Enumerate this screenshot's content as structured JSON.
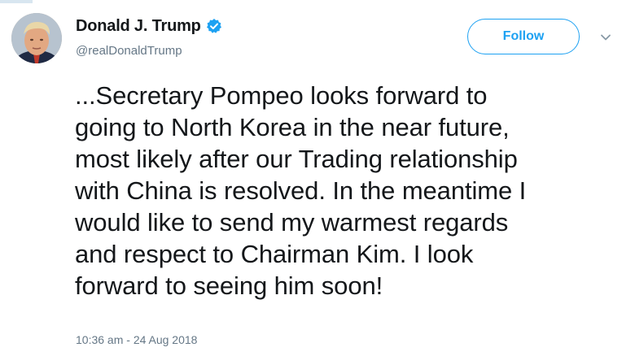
{
  "author": {
    "display_name": "Donald J. Trump",
    "handle": "@realDonaldTrump",
    "verified": true
  },
  "actions": {
    "follow_label": "Follow"
  },
  "tweet": {
    "text": "...Secretary Pompeo looks forward to\ngoing to North Korea in the near future,\nmost likely after our Trading relationship\nwith China is resolved. In the meantime I\nwould like to send my warmest regards\nand respect to Chairman Kim. I look\nforward to seeing him soon!",
    "timestamp": "10:36 am - 24 Aug 2018"
  },
  "icons": {
    "verified": "verified-badge-icon",
    "menu": "chevron-down-icon",
    "avatar": "profile-avatar"
  },
  "colors": {
    "accent": "#1da1f2",
    "secondary_text": "#657786",
    "primary_text": "#14171a"
  }
}
